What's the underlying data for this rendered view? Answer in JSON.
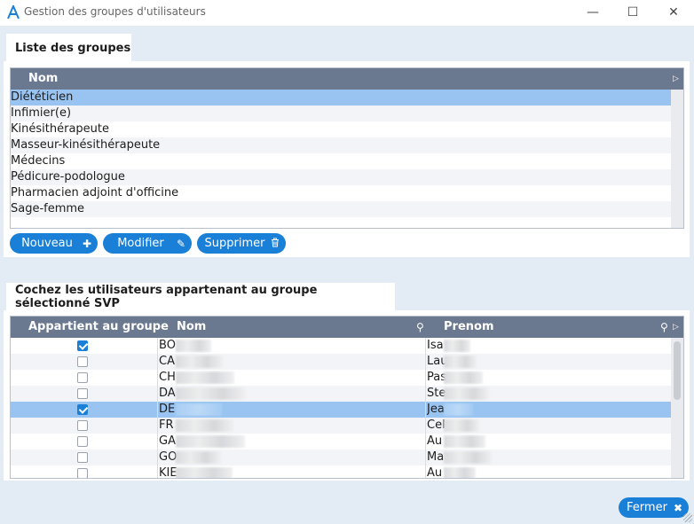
{
  "window": {
    "title": "Gestion des groupes d'utilisateurs",
    "minimize_glyph": "—",
    "maximize_glyph": "☐",
    "close_glyph": "✕"
  },
  "groups": {
    "tab_label": "Liste des groupes",
    "column_header": "Nom",
    "items": [
      "Diététicien",
      "Infimier(e)",
      "Kinésithérapeute",
      "Masseur-kinésithérapeute",
      "Médecins",
      "Pédicure-podologue",
      "Pharmacien adjoint d'officine",
      "Sage-femme"
    ],
    "selected_index": 0,
    "buttons": {
      "new": "Nouveau",
      "edit": "Modifier",
      "delete": "Supprimer"
    }
  },
  "users": {
    "tab_label": "Cochez les utilisateurs appartenant au groupe sélectionné SVP",
    "headers": {
      "belongs": "Appartient au groupe",
      "nom": "Nom",
      "prenom": "Prenom"
    },
    "rows": [
      {
        "nom": "BO",
        "prenom": "Isa",
        "checked": true
      },
      {
        "nom": "CA",
        "prenom": "Lau",
        "checked": false
      },
      {
        "nom": "CH",
        "prenom": "Pas",
        "checked": false
      },
      {
        "nom": "DA",
        "prenom": "Ste",
        "checked": false
      },
      {
        "nom": "DE",
        "prenom": "Jea",
        "checked": true
      },
      {
        "nom": "FR",
        "prenom": "Cel",
        "checked": false
      },
      {
        "nom": "GA",
        "prenom": "Au",
        "checked": false
      },
      {
        "nom": "GO",
        "prenom": "Ma",
        "checked": false
      },
      {
        "nom": "KIE",
        "prenom": "Au",
        "checked": false
      }
    ],
    "selected_index": 4
  },
  "footer": {
    "close_button": "Fermer"
  },
  "colors": {
    "accent": "#1a7fd6",
    "header": "#6a7890",
    "selection": "#99c4f2",
    "background": "#e3ebf4"
  }
}
